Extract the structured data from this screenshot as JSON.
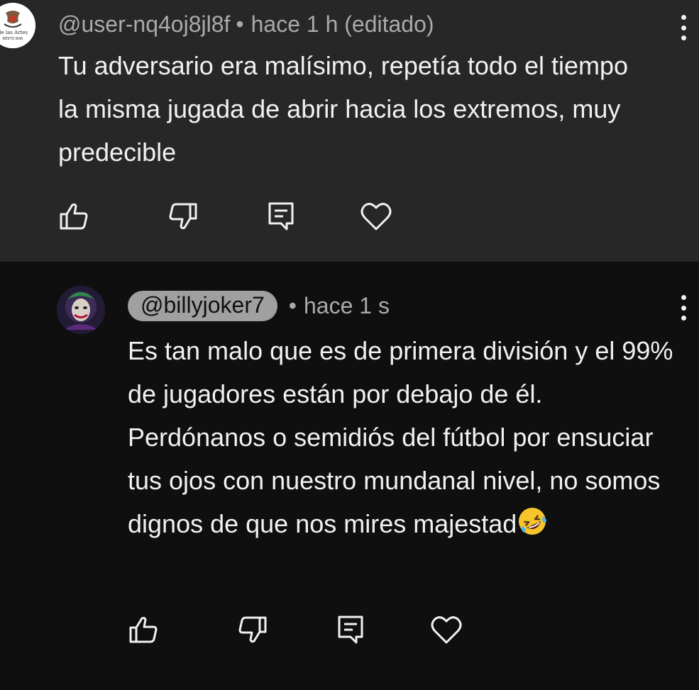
{
  "comments": [
    {
      "author": "@user-nq4oj8jl8f",
      "time": "hace 1 h (editado)",
      "text": "Tu adversario era malísimo, repetía todo el tiempo la misma jugada de abrir hacia los extremos, muy predecible",
      "avatar_text": "de las Artes",
      "avatar_subtext": "RESTO BAR"
    },
    {
      "author": "@billyjoker7",
      "time": "hace 1 s",
      "text": "Es tan malo que es de primera división y el 99% de jugadores están por debajo de él. Perdónanos o semidiós del fútbol por ensuciar tus ojos con nuestro mundanal nivel, no somos dignos de que nos mires majestad",
      "emoji": "rolling-on-the-floor-laughing"
    }
  ],
  "separator": "•",
  "colors": {
    "first_comment_bg": "#272727",
    "second_comment_bg": "#0f0f0f",
    "meta_text": "#aaaaaa",
    "body_text": "#f1f1f1",
    "handle_pill": "#a0a0a0"
  }
}
